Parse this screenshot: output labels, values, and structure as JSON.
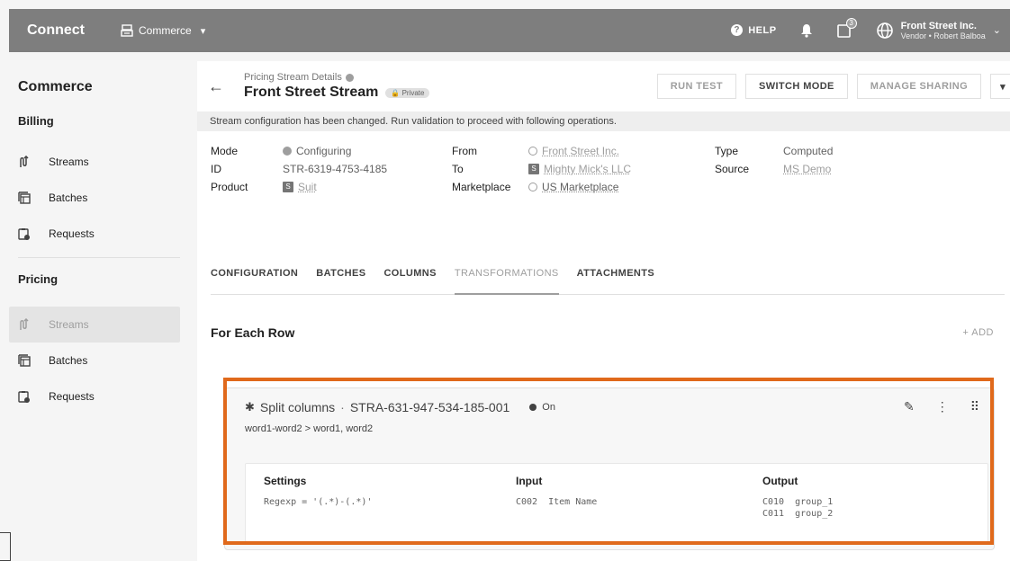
{
  "topbar": {
    "brand": "Connect",
    "module": "Commerce",
    "help": "HELP",
    "task_count": "3",
    "org": "Front Street Inc.",
    "user": "Vendor • Robert Balboa"
  },
  "sidebar": {
    "title": "Commerce",
    "billing_label": "Billing",
    "billing_items": [
      "Streams",
      "Batches",
      "Requests"
    ],
    "pricing_label": "Pricing",
    "pricing_items": [
      "Streams",
      "Batches",
      "Requests"
    ]
  },
  "header": {
    "crumb": "Pricing Stream Details",
    "name": "Front Street Stream",
    "badge": "Private",
    "run_test": "RUN TEST",
    "switch_mode": "SWITCH MODE",
    "manage_sharing": "MANAGE SHARING"
  },
  "notice": "Stream configuration has been changed. Run validation to proceed with following operations.",
  "details": {
    "mode_label": "Mode",
    "mode_value": "Configuring",
    "id_label": "ID",
    "id_value": "STR-6319-4753-4185",
    "product_label": "Product",
    "product_value": "Suit",
    "product_badge": "S",
    "from_label": "From",
    "from_value": "Front Street Inc.",
    "to_label": "To",
    "to_value": "Mighty Mick's LLC",
    "to_badge": "S",
    "marketplace_label": "Marketplace",
    "marketplace_value": "US Marketplace",
    "type_label": "Type",
    "type_value": "Computed",
    "source_label": "Source",
    "source_value": "MS Demo"
  },
  "tabs": [
    "CONFIGURATION",
    "BATCHES",
    "COLUMNS",
    "TRANSFORMATIONS",
    "ATTACHMENTS"
  ],
  "section": {
    "title": "For Each Row",
    "add": "+ ADD"
  },
  "transformation": {
    "name": "Split columns",
    "separator": "·",
    "id": "STRA-631-947-534-185-001",
    "status": "On",
    "summary": "word1-word2 > word1, word2",
    "settings_label": "Settings",
    "settings_value": "Regexp = '(.*)-(.*)'",
    "input_label": "Input",
    "input_value": "C002  Item Name",
    "output_label": "Output",
    "output_values": [
      "C010  group_1",
      "C011  group_2"
    ]
  }
}
